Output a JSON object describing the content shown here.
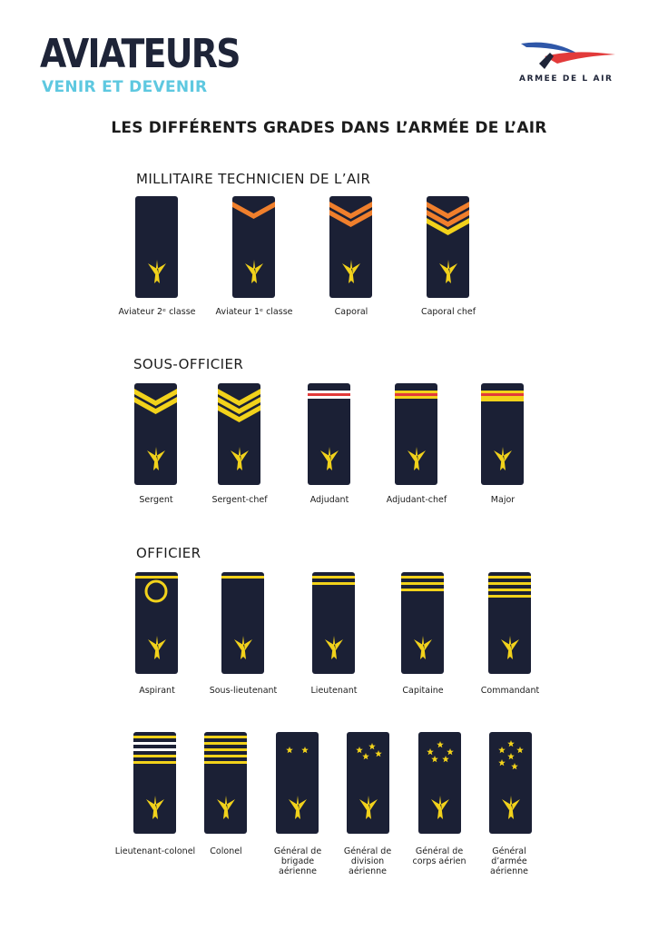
{
  "header": {
    "logo_title": "AVIATEURS",
    "logo_subtitle": "VENIR ET DEVENIR",
    "partner_logo": "ARMEE DE L AIR"
  },
  "page_title": "LES DIFFÉRENTS GRADES DANS L’ARMÉE DE L’AIR",
  "sections": [
    {
      "title": "MILLITAIRE TECHNICIEN DE L’AIR",
      "ranks": [
        "Aviateur 2ᵉ classe",
        "Aviateur 1ᵉ classe",
        "Caporal",
        "Caporal chef"
      ]
    },
    {
      "title": "SOUS-OFFICIER",
      "ranks": [
        "Sergent",
        "Sergent-chef",
        "Adjudant",
        "Adjudant-chef",
        "Major"
      ]
    },
    {
      "title": "OFFICIER",
      "ranks": [
        "Aspirant",
        "Sous-lieutenant",
        "Lieutenant",
        "Capitaine",
        "Commandant"
      ]
    },
    {
      "title": "",
      "ranks": [
        "Lieutenant-colonel",
        "Colonel",
        "Général de brigade aérienne",
        "Général de division aérienne",
        "Général de corps aérien",
        "Général d’armée aérienne"
      ]
    }
  ],
  "colors": {
    "strap": "#1b2035",
    "gold": "#f2d21b",
    "orange": "#f07f2c",
    "red": "#e23a3a",
    "white": "#ffffff",
    "accent": "#5ec8e0"
  }
}
